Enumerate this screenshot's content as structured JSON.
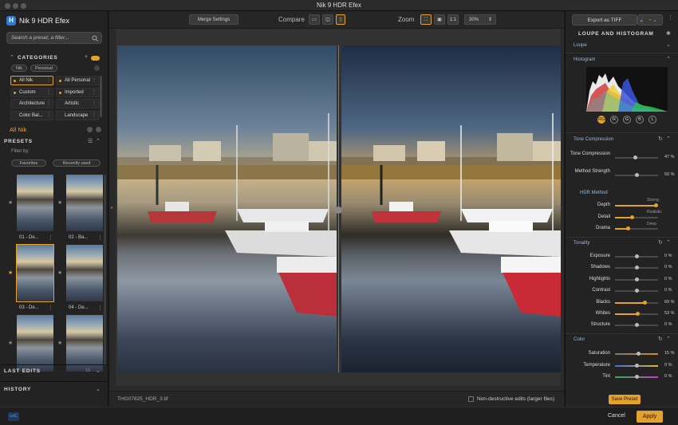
{
  "window": {
    "title": "Nik 9 HDR Efex"
  },
  "left": {
    "app_title": "Nik 9 HDR Efex",
    "logo_letter": "H",
    "search_placeholder": "Search a preset, a filter...",
    "categories_title": "CATEGORIES",
    "source_pills": [
      "Nik",
      "Personal"
    ],
    "categories": [
      {
        "label": "All Nik",
        "selected": true,
        "dot": true
      },
      {
        "label": "All Personal",
        "selected": false,
        "dot": true
      },
      {
        "label": "Custom",
        "selected": false,
        "dot": true
      },
      {
        "label": "Imported",
        "selected": false,
        "dot": true
      },
      {
        "label": "Architecture",
        "selected": false,
        "dot": false
      },
      {
        "label": "Artistic",
        "selected": false,
        "dot": false
      },
      {
        "label": "Color Bal...",
        "selected": false,
        "dot": false
      },
      {
        "label": "Landscape",
        "selected": false,
        "dot": false
      }
    ],
    "current_category": "All Nik",
    "presets_title": "PRESETS",
    "filter_by": "Filter by:",
    "filter_pills": [
      "Favorites",
      "Recently used"
    ],
    "thumbnails": [
      {
        "label": "01 - De...",
        "selected": false,
        "starred": false
      },
      {
        "label": "02 - Ba...",
        "selected": false,
        "starred": false
      },
      {
        "label": "03 - De...",
        "selected": true,
        "starred": true
      },
      {
        "label": "04 - De...",
        "selected": false,
        "starred": false
      },
      {
        "label": "",
        "selected": false,
        "starred": false
      },
      {
        "label": "",
        "selected": false,
        "starred": false
      }
    ],
    "last_edits_title": "LAST EDITS",
    "last_edits_count": "15",
    "history_title": "HISTORY"
  },
  "toolbar": {
    "merge_settings": "Merge Settings",
    "compare_label": "Compare",
    "zoom_label": "Zoom",
    "zoom_one": "1:1",
    "zoom_value": "30%"
  },
  "footer": {
    "filename": "THG07825_HDR_3.tif",
    "nondestructive": "Non-destructive edits (larger files)"
  },
  "right": {
    "export_label": "Export as TIFF",
    "loupe_title": "LOUPE AND HISTOGRAM",
    "loupe_label": "Loupe",
    "histogram_label": "Histogram",
    "channels": [
      "RGB",
      "R",
      "G",
      "B",
      "L"
    ],
    "tone_compression_title": "Tone Compression",
    "tone_sliders": [
      {
        "label": "Tone Compression",
        "value": 47,
        "pct": "47 %",
        "fill": false
      },
      {
        "label": "Method Strength",
        "value": 50,
        "pct": "50 %",
        "fill": false
      }
    ],
    "hdr_method_title": "HDR Method",
    "hdr_sliders": [
      {
        "label": "Depth",
        "value": 95,
        "tag": "Strong"
      },
      {
        "label": "Detail",
        "value": 40,
        "tag": "Realistic"
      },
      {
        "label": "Drama",
        "value": 30,
        "tag": "Deep"
      }
    ],
    "tonality_title": "Tonality",
    "tonality_sliders": [
      {
        "label": "Exposure",
        "value": 50,
        "pct": "0 %",
        "fill": false
      },
      {
        "label": "Shadows",
        "value": 50,
        "pct": "0 %",
        "fill": false
      },
      {
        "label": "Highlights",
        "value": 50,
        "pct": "0 %",
        "fill": false
      },
      {
        "label": "Contrast",
        "value": 50,
        "pct": "0 %",
        "fill": false
      },
      {
        "label": "Blacks",
        "value": 69,
        "pct": "69 %",
        "fill": true
      },
      {
        "label": "Whites",
        "value": 53,
        "pct": "53 %",
        "fill": true
      },
      {
        "label": "Structure",
        "value": 50,
        "pct": "0 %",
        "fill": false
      }
    ],
    "color_title": "Color",
    "color_sliders": [
      {
        "label": "Saturation",
        "value": 55,
        "pct": "15 %",
        "kind": "sat"
      },
      {
        "label": "Temperature",
        "value": 50,
        "pct": "0 %",
        "kind": "temp"
      },
      {
        "label": "Tint",
        "value": 50,
        "pct": "0 %",
        "kind": "tint"
      }
    ],
    "save_preset": "Save Preset"
  },
  "bottom": {
    "cancel": "Cancel",
    "apply": "Apply",
    "badge": "LoC"
  },
  "colors": {
    "accent": "#e4a12c",
    "brand": "#2d7ad6"
  }
}
